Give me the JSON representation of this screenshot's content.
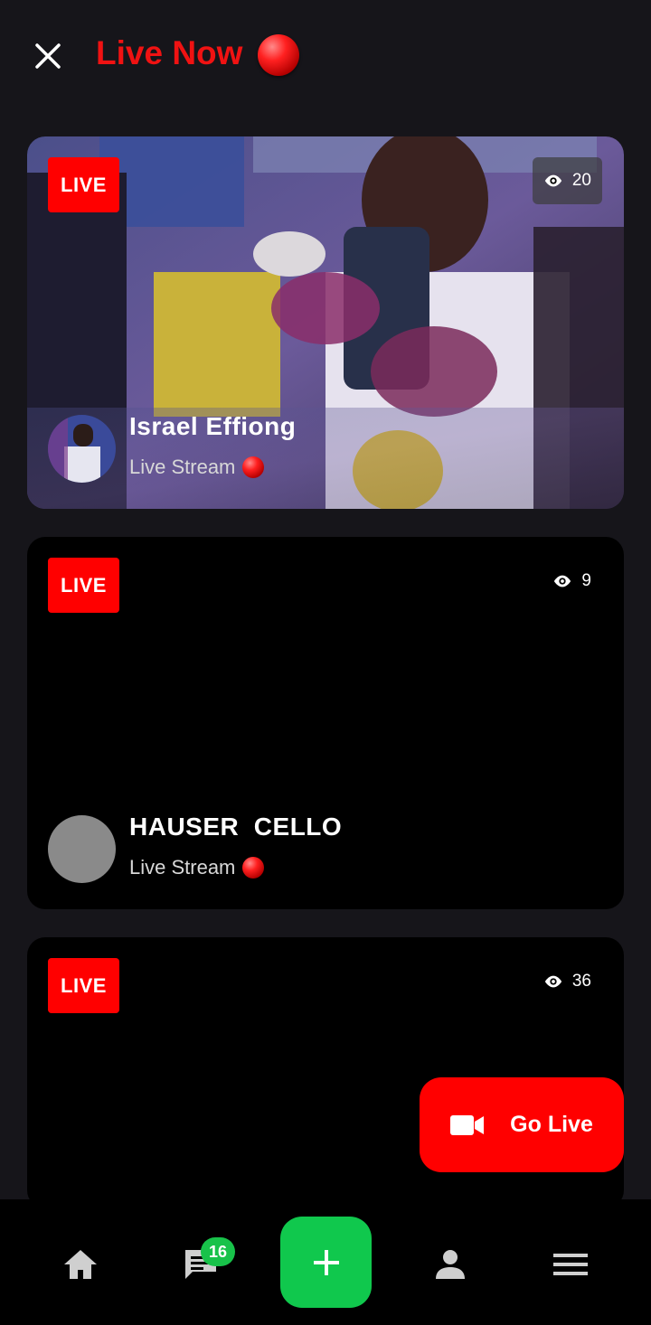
{
  "header": {
    "title": "Live Now",
    "close_icon": "close-icon",
    "live_dot_icon": "red-circle-icon"
  },
  "streams": [
    {
      "badge": "LIVE",
      "viewers": "20",
      "name": "Israel Effiong",
      "subtitle": "Live Stream",
      "has_preview": true
    },
    {
      "badge": "LIVE",
      "viewers": "9",
      "name": "HAUSER  CELLO",
      "subtitle": "Live Stream",
      "has_preview": false
    },
    {
      "badge": "LIVE",
      "viewers": "36",
      "name": "",
      "subtitle": "",
      "has_preview": false
    }
  ],
  "go_live": {
    "label": "Go Live",
    "icon": "video-camera-icon"
  },
  "nav": {
    "items": [
      "home-icon",
      "chat-icon",
      "plus-icon",
      "profile-icon",
      "menu-icon"
    ],
    "chat_badge": "16"
  },
  "colors": {
    "accent_red": "#ff0000",
    "title_red": "#f01212",
    "green": "#10c84d",
    "background": "#16151a"
  }
}
